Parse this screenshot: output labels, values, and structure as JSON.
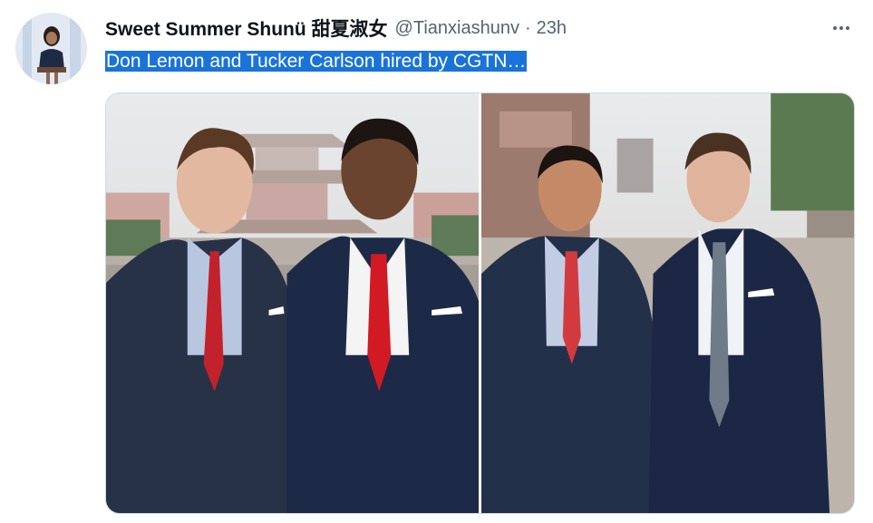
{
  "tweet": {
    "author": {
      "display_name": "Sweet Summer Shunü 甜夏淑女",
      "handle": "@Tianxiashunv",
      "avatar_icon": "profile-photo"
    },
    "separator": "·",
    "timestamp": "23h",
    "text": "Don Lemon and Tucker Carlson hired by CGTN…",
    "more_icon": "ellipsis-icon",
    "media": [
      {
        "kind": "image",
        "scene": "two men in suits, red ties, Chinese architecture"
      },
      {
        "kind": "image",
        "scene": "two men in suits, walled street"
      }
    ]
  },
  "colors": {
    "selection": "#1a73d9",
    "secondary_text": "#536471",
    "border": "#cfd9de"
  }
}
